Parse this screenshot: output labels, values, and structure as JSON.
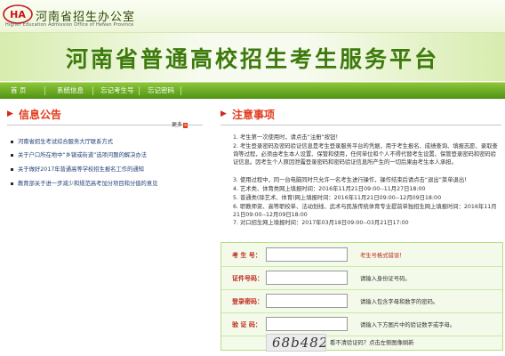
{
  "header": {
    "office_name": "河南省招生办公室",
    "office_name_en": "Higher Education Admission Office of HeNan Province",
    "banner_title": "河南省普通高校招生考生服务平台"
  },
  "nav": {
    "items": [
      "首 页",
      "系统信息",
      "忘记考生号",
      "忘记密码"
    ]
  },
  "announcements": {
    "title": "信息公告",
    "more_label": "更多",
    "items": [
      "河南省招生考试综合服务大厅联系方式",
      "关于户口所在地中“乡镇或街道”选项问题的解决办法",
      "关于做好2017年普通高等学校招生报名工作的通知",
      "教育部关于进一步减少和规范高考加分项目和分值的意见"
    ]
  },
  "notes": {
    "title": "注意事项",
    "items": [
      "1. 考生第一次使用时，请点击“注册”按钮！",
      "2. 考生登录密码及密码验证信息是考生登录服务平台的凭据，用于考生报名、成绩查询、填报志愿、录取查询等过程，必须由考生本人设置、保管和使用，任何单位和个人不得代替考生设置、保管登录密码和密码验证信息。因考生个人原因泄露登录密码和密码验证信息所产生的一切后果由考生本人承担。",
      "3. 使用过程中，同一台电脑同时只允许一名考生进行操作，操作结束后请点击“退出”菜单退出！",
      "4. 艺术类、体育类网上填报时间：2016年11月21日09:00--11月27日18:00",
      "5. 普通类(除艺术、体育)网上填报时间：2016年11月21日09:00--12月09日18:00",
      "6. 职教师资、高等职校单、法动划线、武术与民族传统体育专业提前单独招生网上填报时间：2016年11月21日09:00--12月09日18:00",
      "7. 对口招生网上填报时间：2017年03月18日09:00--03月21日17:00"
    ]
  },
  "login": {
    "rows": [
      {
        "label": "考 生 号：",
        "hint": "考生号格式错误！"
      },
      {
        "label": "证件号码：",
        "hint": "请输入身份证号码。"
      },
      {
        "label": "登录密码：",
        "hint": "请输入包含字母和数字的密码。"
      },
      {
        "label": "验 证 码：",
        "hint": "请输入下方图片中的验证数字或字母。"
      }
    ],
    "captcha_text": "68b482",
    "refresh_text": "看不清验证码？点击左侧图像刷新"
  }
}
